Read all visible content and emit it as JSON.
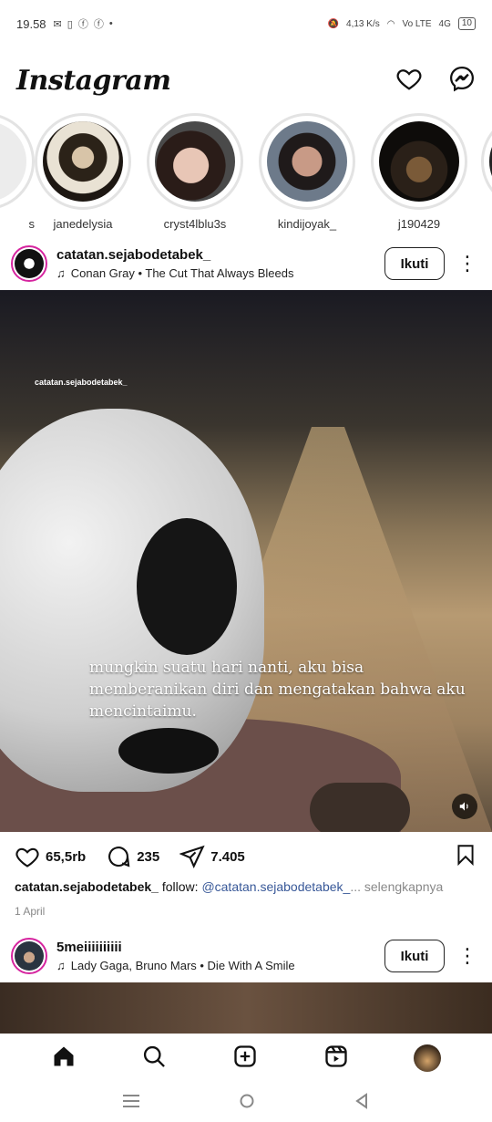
{
  "status": {
    "time": "19.58",
    "net_speed": "4,13",
    "net_unit": "K/s",
    "volte": "Vo LTE",
    "signal": "4G",
    "battery": "10"
  },
  "header": {
    "logo": "Instagram",
    "icons": [
      "heart-icon",
      "messenger-icon"
    ]
  },
  "stories": [
    {
      "name": "s"
    },
    {
      "name": "janedelysia"
    },
    {
      "name": "cryst4lblu3s"
    },
    {
      "name": "kindijoyak_"
    },
    {
      "name": "j190429"
    }
  ],
  "post1": {
    "username": "catatan.sejabodetabek_",
    "music": "Conan Gray • The Cut That Always Bleeds",
    "follow_label": "Ikuti",
    "watermark": "catatan.sejabodetabek_",
    "overlay_text": "mungkin suatu hari nanti, aku bisa memberanikan diri dan mengatakan bahwa aku mencintaimu.",
    "likes": "65,5rb",
    "comments": "235",
    "shares": "7.405",
    "caption_user": "catatan.sejabodetabek_",
    "caption_text": " follow: ",
    "caption_mention": "@catatan.sejabodetabek_",
    "caption_more": "... selengkapnya",
    "date": "1 April"
  },
  "post2": {
    "username": "5meiiiiiiiiii",
    "music": "Lady Gaga, Bruno Mars • Die With A Smile",
    "follow_label": "Ikuti"
  },
  "bottom_nav": [
    "home-icon",
    "search-icon",
    "add-post-icon",
    "reels-icon",
    "profile-avatar"
  ],
  "colors": {
    "story_ring": "#e3e3e3",
    "mention": "#385898",
    "muted": "#888888"
  }
}
